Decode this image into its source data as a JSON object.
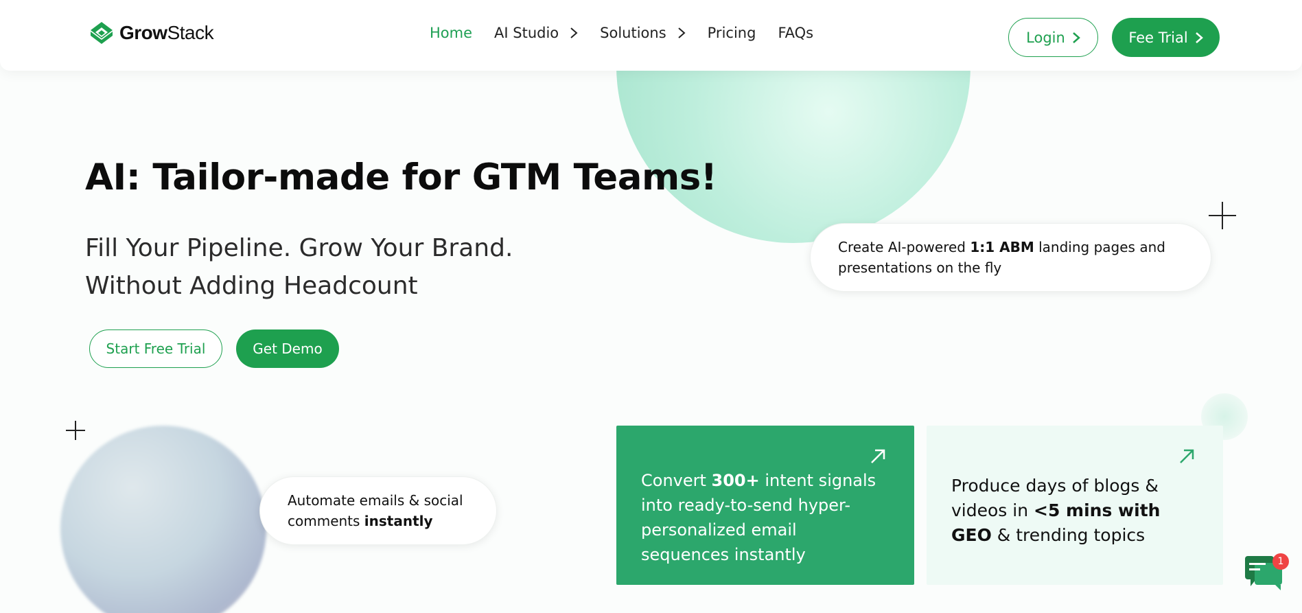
{
  "brand": {
    "name_bold": "Grow",
    "name_light": "Stack",
    "color": "#1ea04f"
  },
  "nav": {
    "items": [
      {
        "label": "Home",
        "active": true
      },
      {
        "label": "AI Studio",
        "has_chevron": true
      },
      {
        "label": "Solutions",
        "has_chevron": true
      },
      {
        "label": "Pricing"
      },
      {
        "label": "FAQs"
      }
    ],
    "login_label": "Login",
    "trial_label": "Fee Trial"
  },
  "hero": {
    "title": "AI: Tailor-made for GTM Teams!",
    "subtitle_line1": "Fill Your Pipeline. Grow Your Brand.",
    "subtitle_line2": "Without Adding Headcount",
    "start_trial_label": "Start Free Trial",
    "demo_label": "Get Demo"
  },
  "pills": {
    "abm": {
      "pre": "Create AI-powered ",
      "bold": "1:1 ABM",
      "post": " landing pages and presentations on the fly"
    },
    "email": {
      "pre": "Automate emails & social comments ",
      "bold": "instantly"
    }
  },
  "cards": {
    "intent": {
      "pre": "Convert ",
      "bold": "300+",
      "post": " intent signals into ready-to-send hyper-personalized email sequences instantly",
      "bg": "#2ca76c"
    },
    "blogs": {
      "pre": "Produce days of blogs & videos in ",
      "bold": "<5 mins with GEO",
      "post": " & trending topics",
      "bg": "#eefaf5"
    }
  },
  "chat": {
    "badge_count": "1"
  },
  "icons": [
    "logo-mark-icon",
    "chevron-right-icon",
    "arrow-up-right-icon",
    "chat-bubble-icon",
    "plus-icon"
  ]
}
